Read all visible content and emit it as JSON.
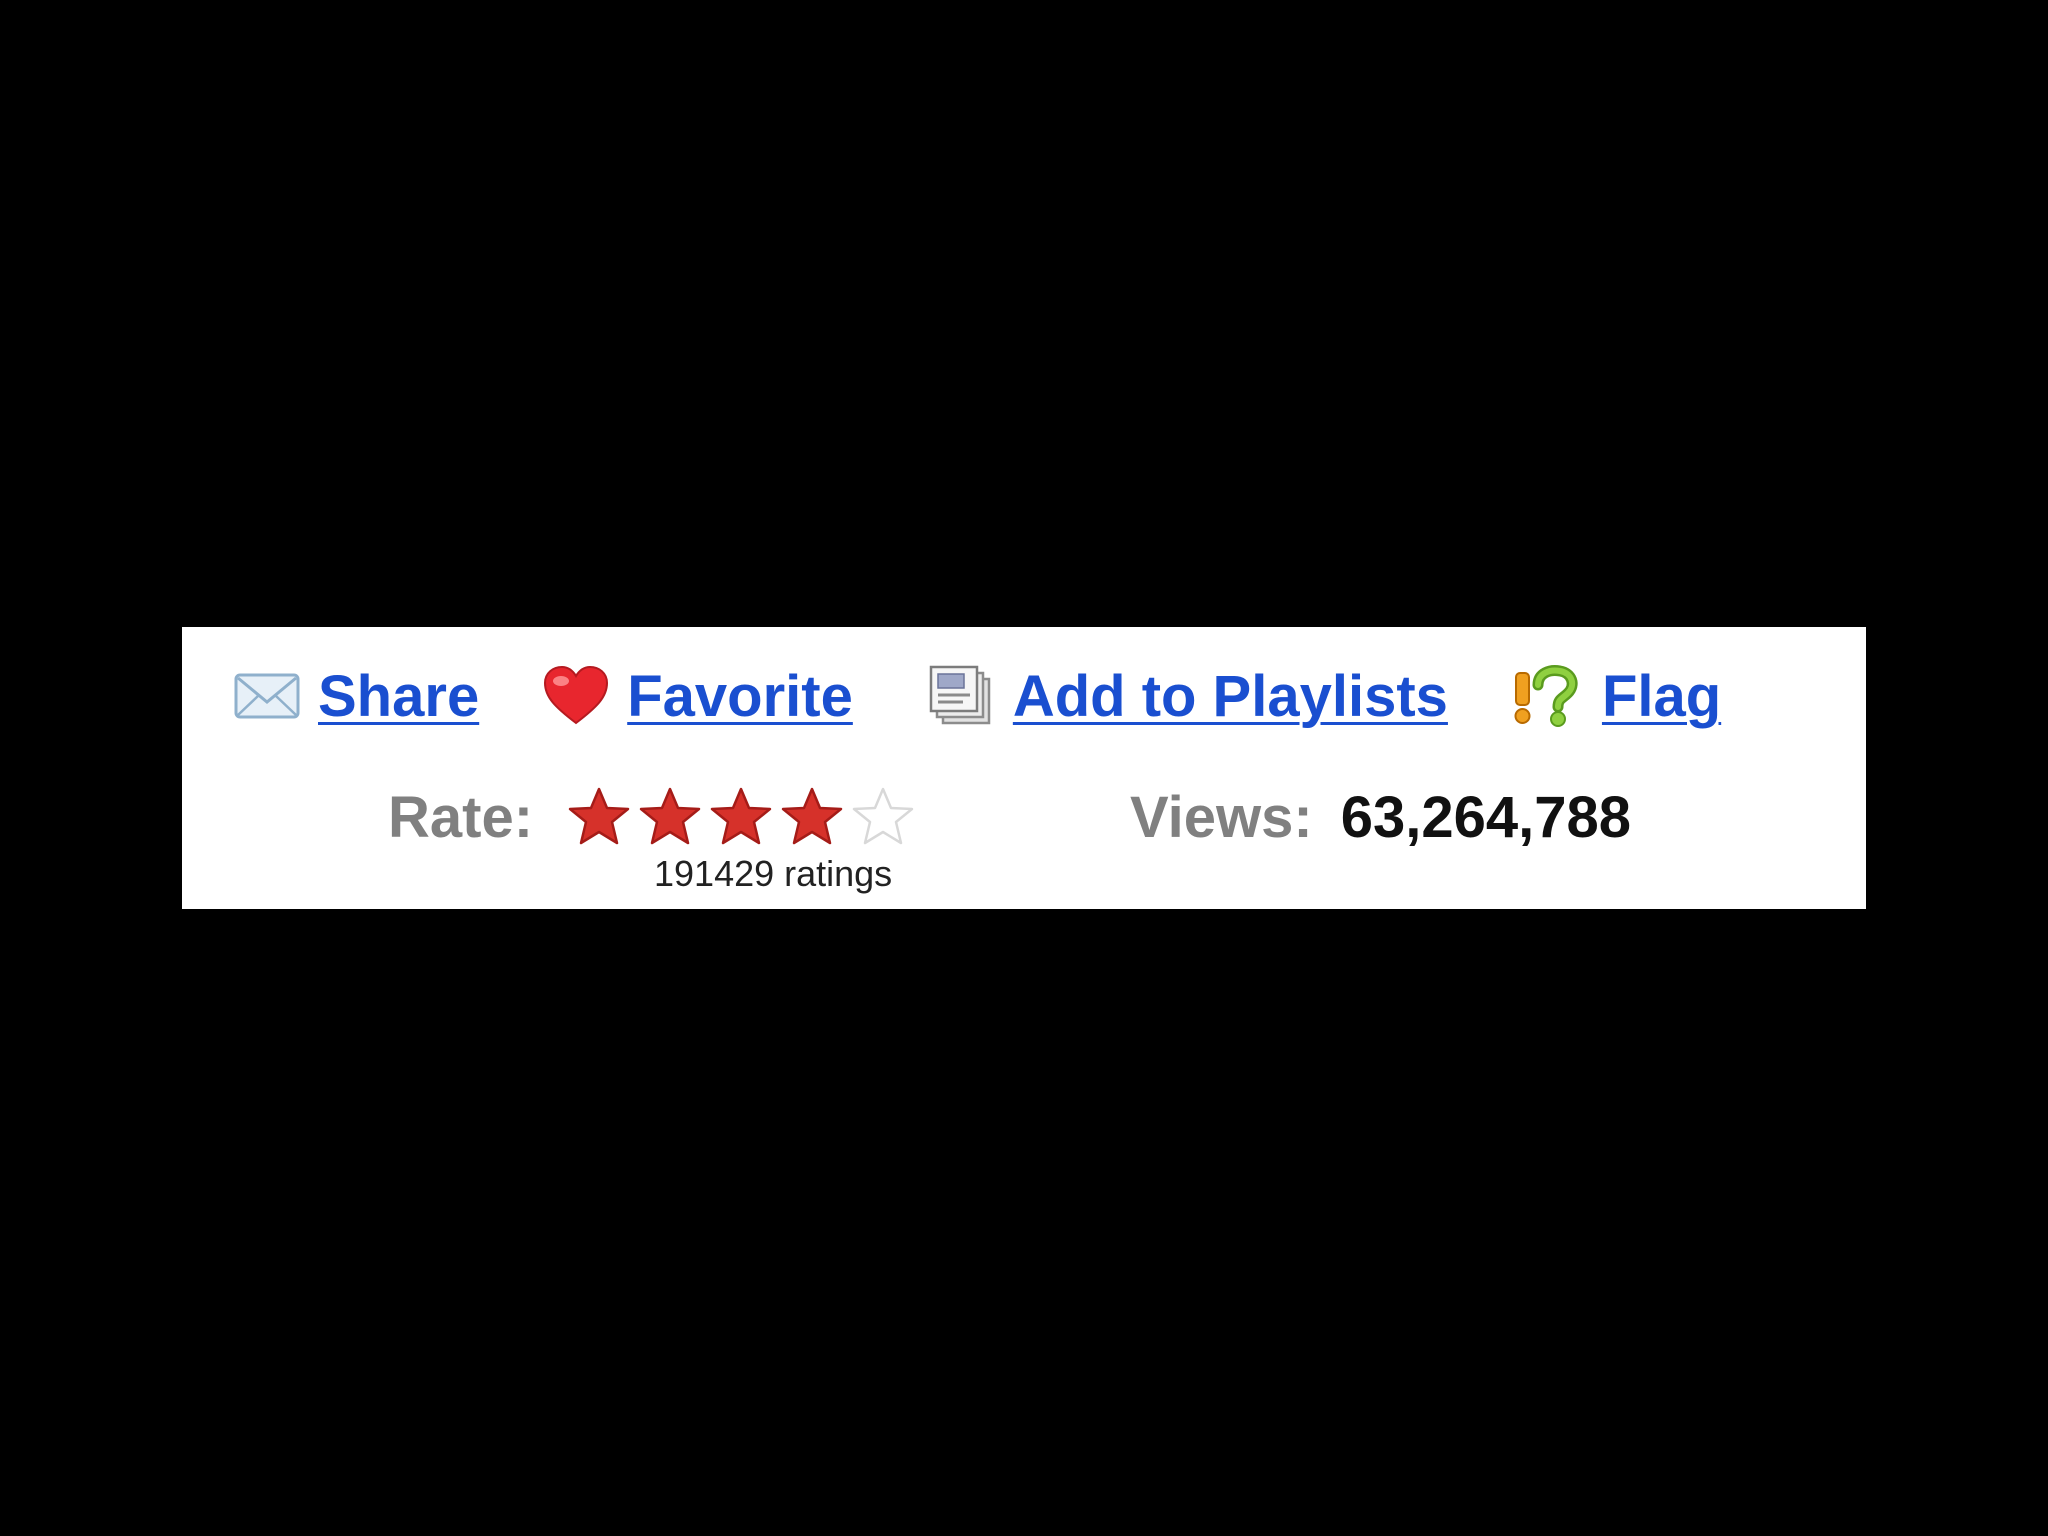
{
  "actions": {
    "share": {
      "label": "Share",
      "icon": "envelope-icon"
    },
    "favorite": {
      "label": "Favorite",
      "icon": "heart-icon"
    },
    "playlists": {
      "label": "Add to Playlists",
      "icon": "playlist-icon"
    },
    "flag": {
      "label": "Flag",
      "icon": "flag-icon"
    }
  },
  "rating": {
    "label": "Rate:",
    "stars_filled": 4,
    "stars_total": 5,
    "count_text": "191429 ratings"
  },
  "views": {
    "label": "Views:",
    "value": "63,264,788"
  },
  "colors": {
    "link": "#1a4fd0",
    "label_gray": "#808080",
    "star_filled": "#d6312a",
    "star_empty": "#d8d8d8",
    "heart": "#e8262e"
  }
}
